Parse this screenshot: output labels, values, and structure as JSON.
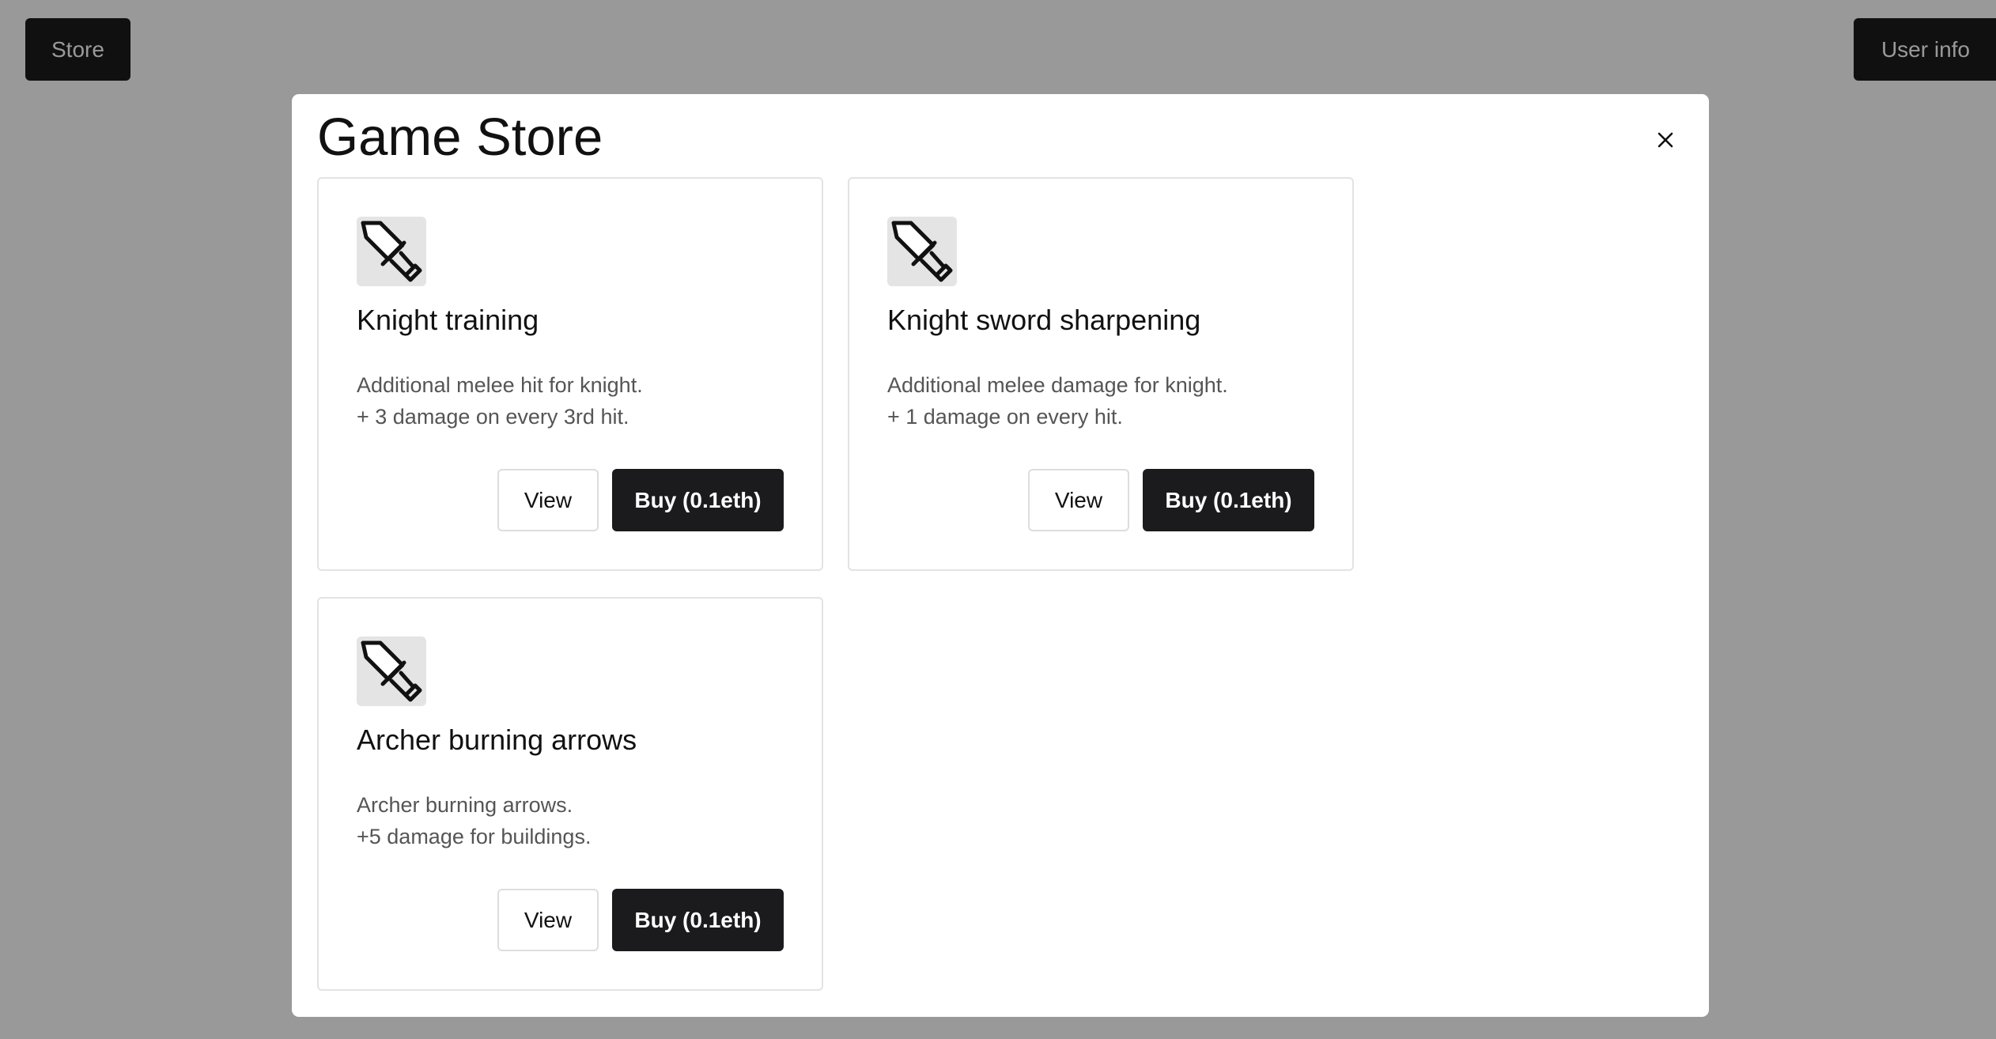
{
  "page": {
    "store_button": "Store",
    "user_info_button": "User info"
  },
  "modal": {
    "title": "Game Store",
    "close_icon": "close-icon",
    "items": [
      {
        "title": "Knight training",
        "icon": "sword-icon",
        "description": [
          "Additional melee hit for knight.",
          "+ 3 damage on every 3rd hit."
        ],
        "view_label": "View",
        "buy_label": "Buy (0.1eth)"
      },
      {
        "title": "Knight sword sharpening",
        "icon": "sword-icon",
        "description": [
          "Additional melee damage for knight.",
          "+ 1 damage on every hit."
        ],
        "view_label": "View",
        "buy_label": "Buy (0.1eth)"
      },
      {
        "title": "Archer burning arrows",
        "icon": "sword-icon",
        "description": [
          "Archer burning arrows.",
          "+5 damage for buildings."
        ],
        "view_label": "View",
        "buy_label": "Buy (0.1eth)"
      }
    ]
  },
  "colors": {
    "overlay": "#999999",
    "primary_button": "#1b1b1d",
    "card_border": "#e3e3e3",
    "icon_bg": "#e4e4e4"
  }
}
